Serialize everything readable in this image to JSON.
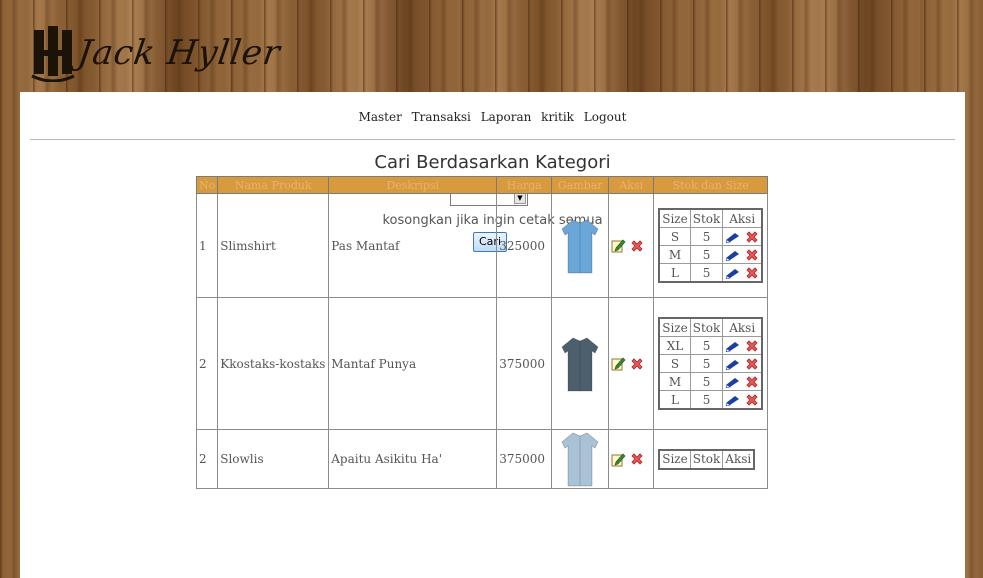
{
  "brand": {
    "name": "Jack Hyller"
  },
  "nav": {
    "items": [
      "Master",
      "Transaksi",
      "Laporan",
      "kritik",
      "Logout"
    ]
  },
  "search": {
    "title": "Cari Berdasarkan Kategori",
    "selected": "",
    "hint": "kosongkan jika ingin cetak semua",
    "button_label": "Cari"
  },
  "table": {
    "headers": [
      "No",
      "Nama Produk",
      "Deskripsi",
      "Harga",
      "Gambar",
      "Aksi",
      "Stok dan Size"
    ],
    "stock_headers": [
      "Size",
      "Stok",
      "Aksi"
    ],
    "rows": [
      {
        "no": "1",
        "name": "Slimshirt",
        "desc": "Pas Mantaf",
        "price": "325000",
        "shirt_color": "#6aa6d8",
        "stock": [
          {
            "size": "S",
            "qty": "5"
          },
          {
            "size": "M",
            "qty": "5"
          },
          {
            "size": "L",
            "qty": "5"
          }
        ]
      },
      {
        "no": "2",
        "name": "Kkostaks-kostaks",
        "desc": "Mantaf Punya",
        "price": "375000",
        "shirt_color": "#4d5f6c",
        "stock": [
          {
            "size": "XL",
            "qty": "5"
          },
          {
            "size": "S",
            "qty": "5"
          },
          {
            "size": "M",
            "qty": "5"
          },
          {
            "size": "L",
            "qty": "5"
          }
        ]
      },
      {
        "no": "2",
        "name": "Slowlis",
        "desc": "Apaitu Asikitu Ha'",
        "price": "375000",
        "shirt_color": "#a9c2d6",
        "stock": []
      }
    ]
  },
  "colors": {
    "header_bg": "#d79a3f",
    "header_text": "#e8b36b",
    "link": "#1a3fa0"
  }
}
